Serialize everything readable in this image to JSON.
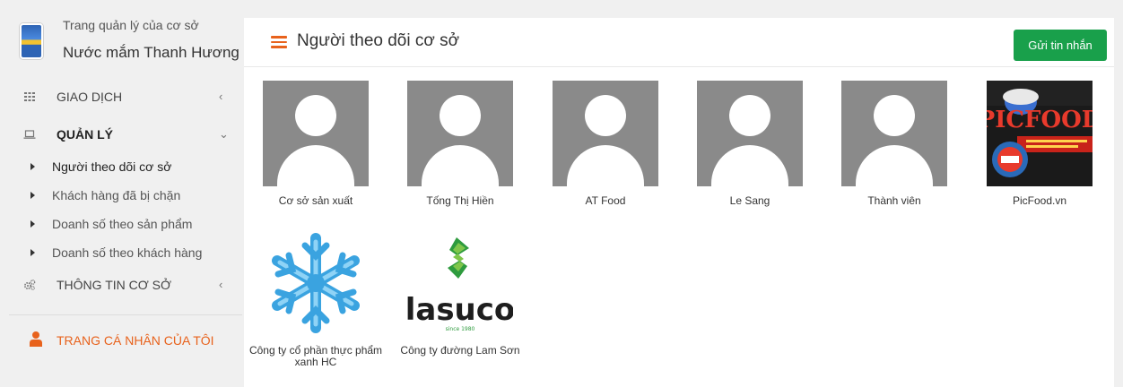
{
  "brand": {
    "subtitle": "Trang quản lý của cơ sở",
    "name": "Nước mắm Thanh Hương"
  },
  "menu": {
    "items": [
      {
        "label": "GIAO DỊCH",
        "icon": "grid-icon",
        "arrow": "‹"
      },
      {
        "label": "QUẢN LÝ",
        "icon": "laptop-icon",
        "arrow": "⌄"
      },
      {
        "label": "THÔNG TIN CƠ SỞ",
        "icon": "cogs-icon",
        "arrow": "‹"
      }
    ],
    "sub_items": [
      {
        "label": "Người theo dõi cơ sở"
      },
      {
        "label": "Khách hàng đã bị chặn"
      },
      {
        "label": "Doanh số theo sản phẩm"
      },
      {
        "label": "Doanh số theo khách hàng"
      }
    ],
    "profile_label": "TRANG CÁ NHÂN CỦA TÔI"
  },
  "header": {
    "title": "Người theo dõi cơ sở",
    "send_button": "Gửi tin nhắn"
  },
  "followers": [
    {
      "name": "Cơ sở sản xuất",
      "avatar": "default-avatar"
    },
    {
      "name": "Tống Thị Hiền",
      "avatar": "default-avatar"
    },
    {
      "name": "AT Food",
      "avatar": "default-avatar"
    },
    {
      "name": "Le Sang",
      "avatar": "default-avatar"
    },
    {
      "name": "Thành viên",
      "avatar": "default-avatar"
    },
    {
      "name": "PicFood.vn",
      "avatar": "picfood-logo",
      "logo_text": "PICFOOD"
    },
    {
      "name": "Công ty cổ phần thực phẩm xanh HC",
      "avatar": "snowflake-logo"
    },
    {
      "name": "Công ty đường Lam Sơn",
      "avatar": "lasuco-logo",
      "logo_text": "lasuco",
      "logo_subtext": "since 1980"
    }
  ],
  "colors": {
    "accent": "#e8621c",
    "button": "#19a04b",
    "avatar_bg": "#8a8a8a"
  }
}
